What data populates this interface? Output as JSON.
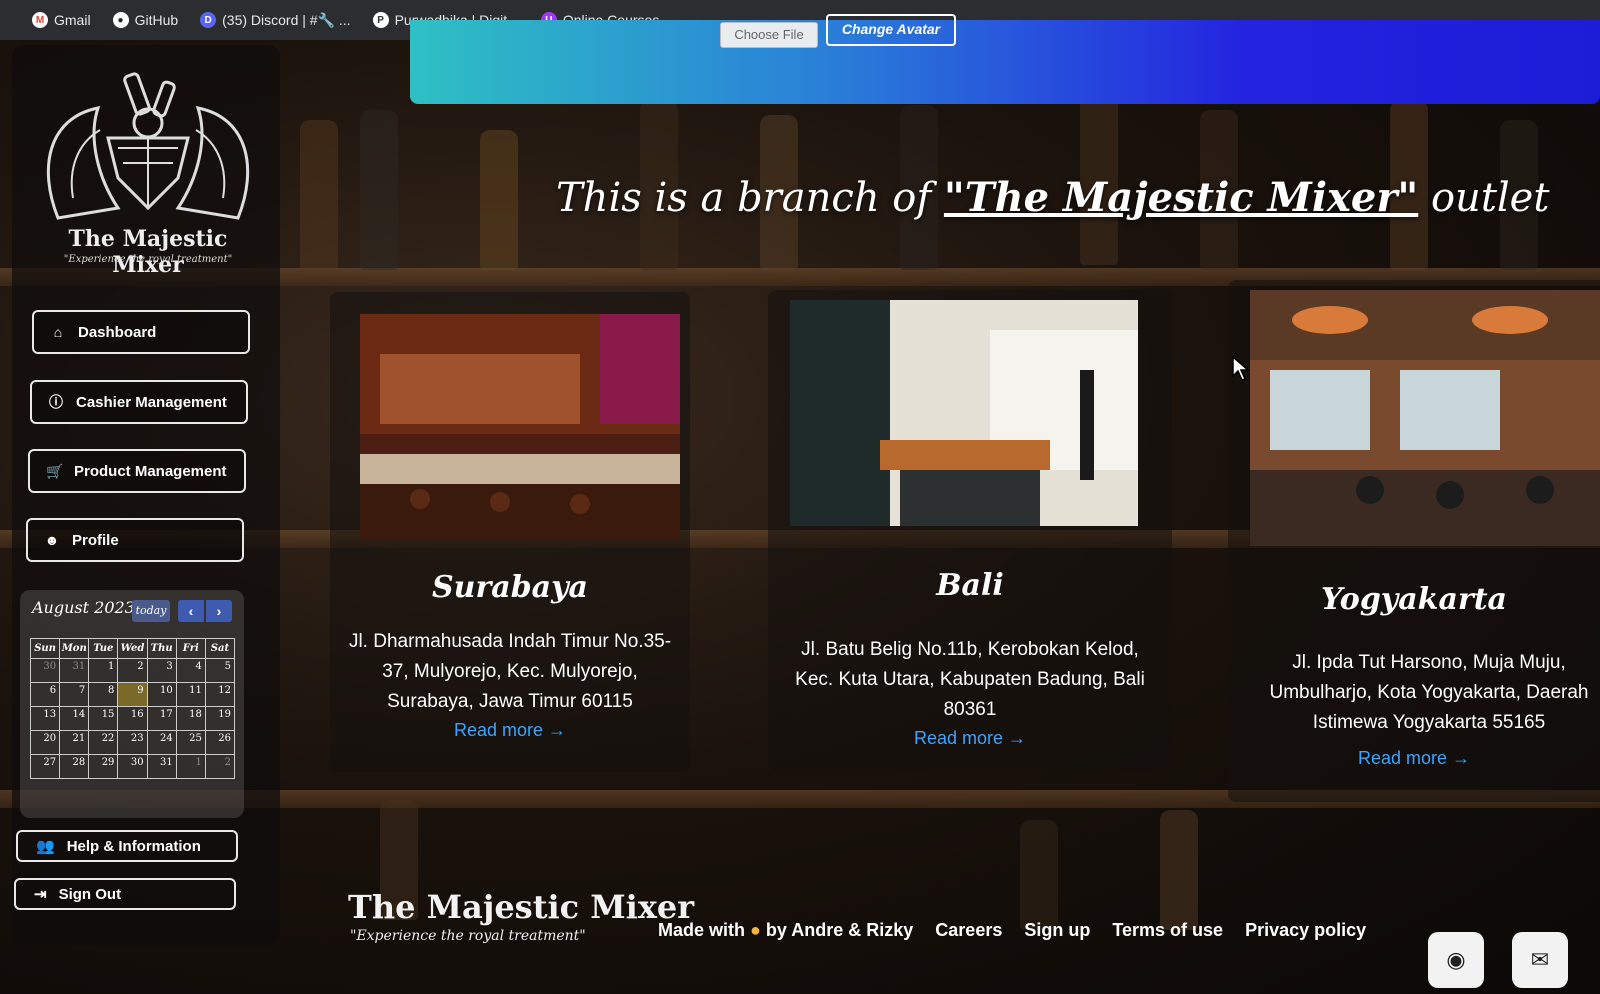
{
  "bookmarks": [
    {
      "label": "Gmail",
      "icon": "gmail-icon",
      "color": "#ea4335"
    },
    {
      "label": "GitHub",
      "icon": "github-icon",
      "color": "#ffffff"
    },
    {
      "label": "(35) Discord | #🔧 ...",
      "icon": "discord-icon",
      "color": "#5865f2"
    },
    {
      "label": "Purwadhika | Digit...",
      "icon": "purwadhika-icon",
      "color": "#ffffff"
    },
    {
      "label": "Online Courses - ...",
      "icon": "udemy-icon",
      "color": "#a435f0"
    }
  ],
  "profile_upload": {
    "choose_file": "Choose File",
    "change_avatar": "Change Avatar"
  },
  "brand": {
    "name": "The Majestic Mixer",
    "tagline": "\"Experience the royal treatment\""
  },
  "nav": [
    {
      "label": "Dashboard",
      "icon": "home-icon"
    },
    {
      "label": "Cashier Management",
      "icon": "info-circle-icon"
    },
    {
      "label": "Product Management",
      "icon": "cart-icon"
    },
    {
      "label": "Profile",
      "icon": "user-icon"
    }
  ],
  "calendar": {
    "title": "August 2023",
    "today_label": "today",
    "weekdays": [
      "Sun",
      "Mon",
      "Tue",
      "Wed",
      "Thu",
      "Fri",
      "Sat"
    ],
    "days": [
      "30",
      "31",
      "1",
      "2",
      "3",
      "4",
      "5",
      "6",
      "7",
      "8",
      "9",
      "10",
      "11",
      "12",
      "13",
      "14",
      "15",
      "16",
      "17",
      "18",
      "19",
      "20",
      "21",
      "22",
      "23",
      "24",
      "25",
      "26",
      "27",
      "28",
      "29",
      "30",
      "31",
      "1",
      "2"
    ],
    "current_day": "9"
  },
  "bottom_nav": [
    {
      "label": "Help & Information",
      "icon": "users-icon"
    },
    {
      "label": "Sign Out",
      "icon": "sign-out-icon"
    }
  ],
  "headline": {
    "prefix": "This is a branch of",
    "brand": "\"The Majestic Mixer\"",
    "suffix": "outlet"
  },
  "branches": [
    {
      "name": "Surabaya",
      "address": "Jl. Dharmahusada Indah Timur No.35-37, Mulyorejo, Kec. Mulyorejo, Surabaya, Jawa Timur 60115",
      "link": "Read more →"
    },
    {
      "name": "Bali",
      "address": "Jl. Batu Belig No.11b, Kerobokan Kelod, Kec. Kuta Utara, Kabupaten Badung, Bali 80361",
      "link": "Read more →"
    },
    {
      "name": "Yogyakarta",
      "address": "Jl. Ipda Tut Harsono, Muja Muju, Umbulharjo, Kota Yogyakarta, Daerah Istimewa Yogyakarta 55165",
      "link": "Read more →"
    }
  ],
  "footer": {
    "logo": "The Majestic Mixer",
    "tagline": "\"Experience the royal treatment\"",
    "made_with_prefix": "Made with",
    "made_with_suffix": "by Andre & Rizky",
    "links": [
      "Careers",
      "Sign up",
      "Terms of use",
      "Privacy policy"
    ],
    "social": [
      "github-icon",
      "mail-icon"
    ]
  },
  "colors": {
    "link": "#3da4ff",
    "banner_start": "#2ec0c4",
    "banner_end": "#1d1dd8"
  }
}
